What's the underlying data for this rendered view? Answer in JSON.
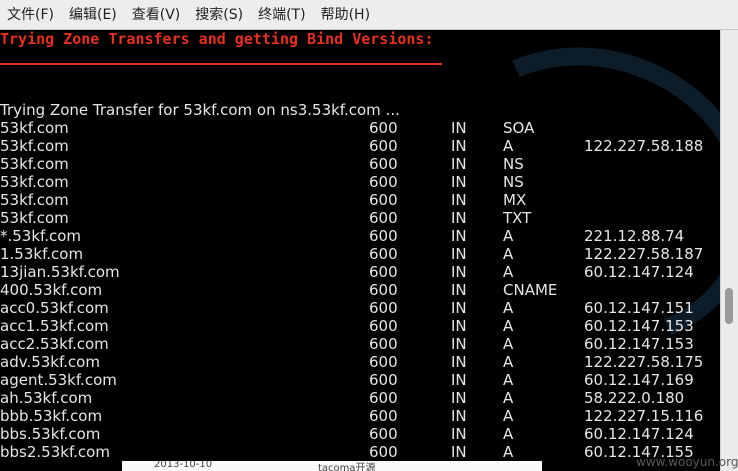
{
  "menu": [
    {
      "label": "文件(F)"
    },
    {
      "label": "编辑(E)"
    },
    {
      "label": "查看(V)"
    },
    {
      "label": "搜索(S)"
    },
    {
      "label": "终端(T)"
    },
    {
      "label": "帮助(H)"
    }
  ],
  "terminal": {
    "heading": "Trying Zone Transfers and getting Bind Versions:",
    "status_line": "Trying Zone Transfer for 53kf.com on ns3.53kf.com ...",
    "records": [
      {
        "name": "53kf.com",
        "ttl": "600",
        "class": "IN",
        "type": "SOA",
        "data": ""
      },
      {
        "name": "53kf.com",
        "ttl": "600",
        "class": "IN",
        "type": "A",
        "data": "122.227.58.188"
      },
      {
        "name": "53kf.com",
        "ttl": "600",
        "class": "IN",
        "type": "NS",
        "data": ""
      },
      {
        "name": "53kf.com",
        "ttl": "600",
        "class": "IN",
        "type": "NS",
        "data": ""
      },
      {
        "name": "53kf.com",
        "ttl": "600",
        "class": "IN",
        "type": "MX",
        "data": ""
      },
      {
        "name": "53kf.com",
        "ttl": "600",
        "class": "IN",
        "type": "TXT",
        "data": ""
      },
      {
        "name": "*.53kf.com",
        "ttl": "600",
        "class": "IN",
        "type": "A",
        "data": "221.12.88.74"
      },
      {
        "name": "1.53kf.com",
        "ttl": "600",
        "class": "IN",
        "type": "A",
        "data": "122.227.58.187"
      },
      {
        "name": "13jian.53kf.com",
        "ttl": "600",
        "class": "IN",
        "type": "A",
        "data": "60.12.147.124"
      },
      {
        "name": "400.53kf.com",
        "ttl": "600",
        "class": "IN",
        "type": "CNAME",
        "data": ""
      },
      {
        "name": "acc0.53kf.com",
        "ttl": "600",
        "class": "IN",
        "type": "A",
        "data": "60.12.147.151"
      },
      {
        "name": "acc1.53kf.com",
        "ttl": "600",
        "class": "IN",
        "type": "A",
        "data": "60.12.147.153"
      },
      {
        "name": "acc2.53kf.com",
        "ttl": "600",
        "class": "IN",
        "type": "A",
        "data": "60.12.147.153"
      },
      {
        "name": "adv.53kf.com",
        "ttl": "600",
        "class": "IN",
        "type": "A",
        "data": "122.227.58.175"
      },
      {
        "name": "agent.53kf.com",
        "ttl": "600",
        "class": "IN",
        "type": "A",
        "data": "60.12.147.169"
      },
      {
        "name": "ah.53kf.com",
        "ttl": "600",
        "class": "IN",
        "type": "A",
        "data": "58.222.0.180"
      },
      {
        "name": "bbb.53kf.com",
        "ttl": "600",
        "class": "IN",
        "type": "A",
        "data": "122.227.15.116"
      },
      {
        "name": "bbs.53kf.com",
        "ttl": "600",
        "class": "IN",
        "type": "A",
        "data": "60.12.147.124"
      },
      {
        "name": "bbs2.53kf.com",
        "ttl": "600",
        "class": "IN",
        "type": "A",
        "data": "60.12.147.155"
      }
    ]
  },
  "watermark": {
    "logo": "KALI",
    "site": "www.wooyun.org"
  },
  "background_window": {
    "text1": "2013-10-10",
    "text2": "tacoma开源"
  },
  "colors": {
    "heading": "#e83020",
    "text": "#e6e6e6",
    "background": "#000000",
    "menubar": "#ededed"
  }
}
